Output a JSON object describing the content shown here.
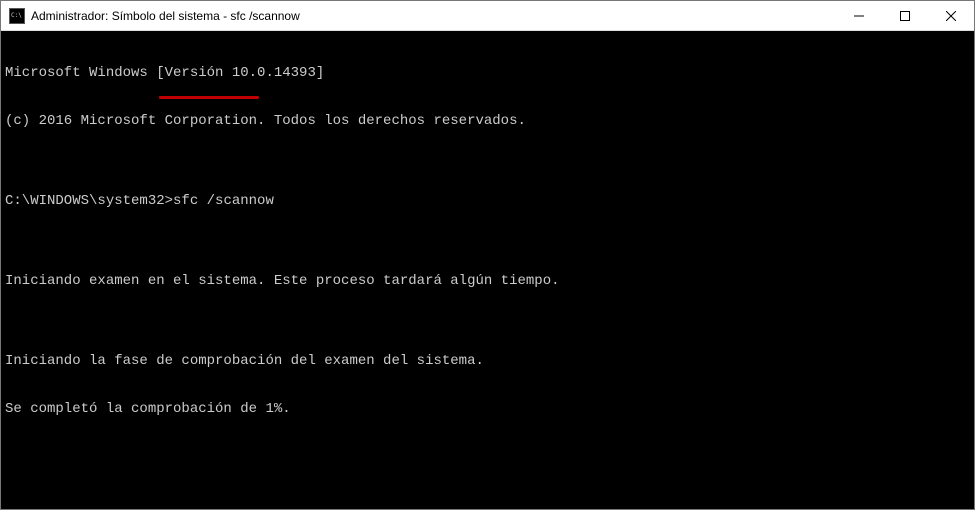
{
  "titlebar": {
    "title": "Administrador: Símbolo del sistema - sfc  /scannow"
  },
  "console": {
    "line1": "Microsoft Windows [Versión 10.0.14393]",
    "line2": "(c) 2016 Microsoft Corporation. Todos los derechos reservados.",
    "blank1": "",
    "promptPrefix": "C:\\WINDOWS\\system32>",
    "command": "sfc /scannow",
    "blank2": "",
    "line3": "Iniciando examen en el sistema. Este proceso tardará algún tiempo.",
    "blank3": "",
    "line4": "Iniciando la fase de comprobación del examen del sistema.",
    "line5": "Se completó la comprobación de 1%."
  }
}
